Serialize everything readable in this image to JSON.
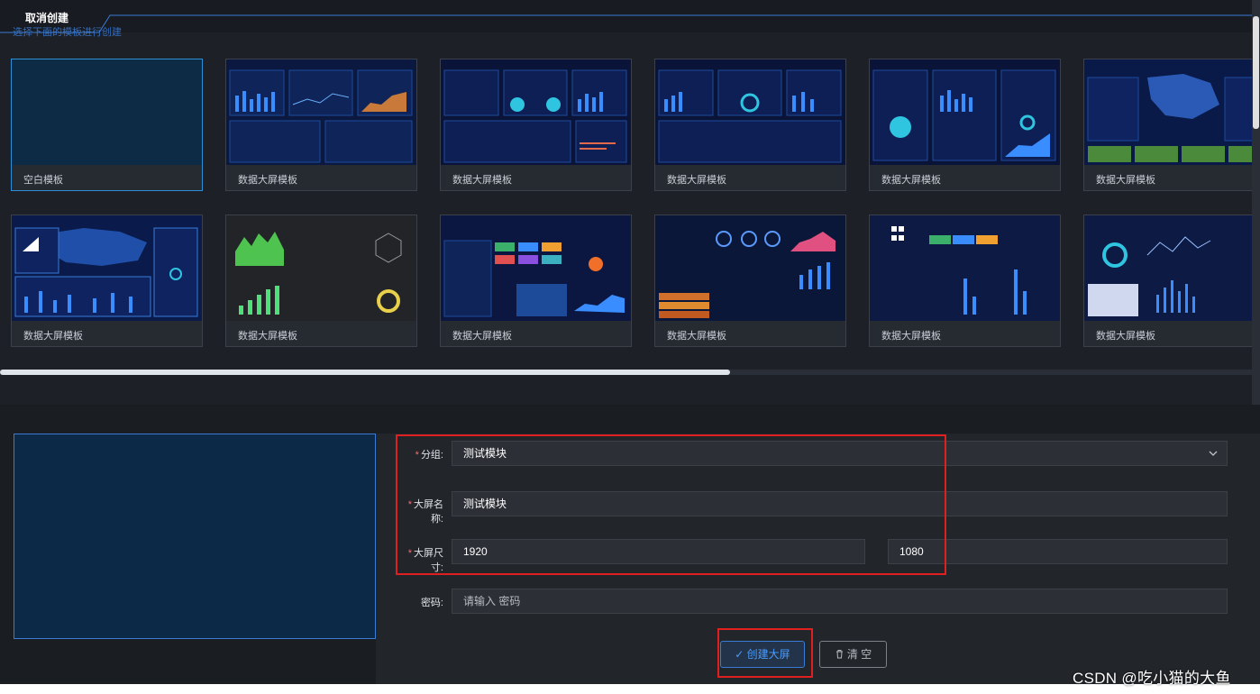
{
  "header": {
    "tab_title": "取消创建",
    "subtitle": "选择下面的模板进行创建"
  },
  "templates": [
    {
      "label": "空白模板"
    },
    {
      "label": "数据大屏模板"
    },
    {
      "label": "数据大屏模板"
    },
    {
      "label": "数据大屏模板"
    },
    {
      "label": "数据大屏模板"
    },
    {
      "label": "数据大屏模板"
    },
    {
      "label": "数据大屏模板"
    },
    {
      "label": "数据大屏模板"
    },
    {
      "label": "数据大屏模板"
    },
    {
      "label": "数据大屏模板"
    },
    {
      "label": "数据大屏模板"
    },
    {
      "label": "数据大屏模板"
    }
  ],
  "form": {
    "group_label": "分组:",
    "group_value": "测试模块",
    "name_label": "大屏名称:",
    "name_value": "测试模块",
    "size_label": "大屏尺寸:",
    "width_value": "1920",
    "height_value": "1080",
    "password_label": "密码:",
    "password_placeholder": "请输入 密码",
    "required_mark": "*"
  },
  "buttons": {
    "create": "✓ 创建大屏",
    "clear": "清 空"
  },
  "watermark": "CSDN @吃小猫的大鱼",
  "colors": {
    "accent": "#3a7bd5",
    "highlight_box": "#e02020",
    "panel_bg": "#1d2027"
  }
}
